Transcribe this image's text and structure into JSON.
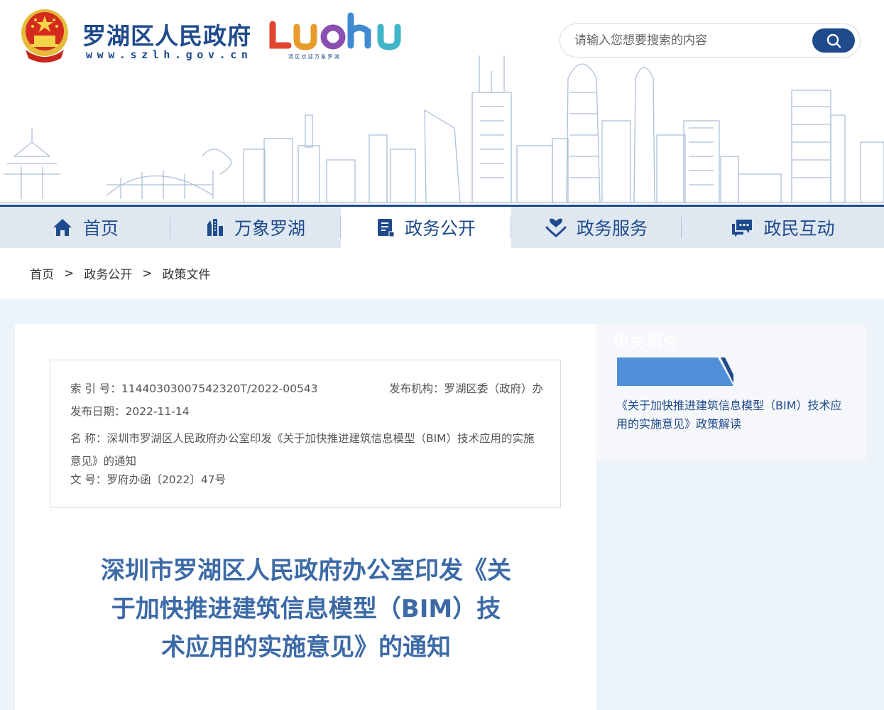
{
  "header": {
    "site_title": "罗湖区人民政府",
    "site_url": "www.szlh.gov.cn",
    "brand_logo_text": "LUOHU",
    "brand_tagline": "清 区 欢 迎   万 象 罗 湖",
    "search_placeholder": "请输入您想要搜索的内容"
  },
  "nav": {
    "items": [
      {
        "label": "首页",
        "icon": "home-icon"
      },
      {
        "label": "万象罗湖",
        "icon": "city-icon"
      },
      {
        "label": "政务公开",
        "icon": "document-icon",
        "active": true
      },
      {
        "label": "政务服务",
        "icon": "heart-hand-icon"
      },
      {
        "label": "政民互动",
        "icon": "chat-icon"
      }
    ]
  },
  "breadcrumb": {
    "items": [
      "首页",
      "政务公开",
      "政策文件"
    ],
    "separator": ">"
  },
  "meta": {
    "index_label": "索 引 号：",
    "index_value": "11440303007542320T/2022-00543",
    "publisher_label": "发布机构：",
    "publisher_value": "罗湖区委（政府）办",
    "date_label": "发布日期：",
    "date_value": "2022-11-14",
    "name_label": "名 称：",
    "name_value": "深圳市罗湖区人民政府办公室印发《关于加快推进建筑信息模型（BIM）技术应用的实施意见》的通知",
    "docno_label": "文 号：",
    "docno_value": "罗府办函〔2022〕47号"
  },
  "document": {
    "title": "深圳市罗湖区人民政府办公室印发《关于加快推进建筑信息模型（BIM）技术应用的实施意见》的通知"
  },
  "sidebar": {
    "related_title": "相关稿件",
    "related_link": "《关于加快推进建筑信息模型（BIM）技术应用的实施意见》政策解读"
  },
  "colors": {
    "brand_blue": "#1f4a8c",
    "title_blue": "#3c6aa6",
    "tab_blue": "#4f8fd8",
    "page_bg": "#ecf3f9"
  }
}
